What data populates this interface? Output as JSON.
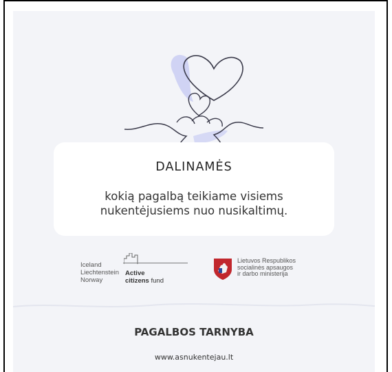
{
  "headline": "DALINAMĖS",
  "subline_1": "kokią pagalbą teikiame visiems",
  "subline_2": "nukentėjusiems nuo nusikaltimų.",
  "eea_grants": {
    "countries": [
      "Iceland",
      "Liechtenstein",
      "Norway"
    ],
    "fund_word_1": "Active",
    "fund_word_2": "citizens",
    "fund_word_3": "fund"
  },
  "ministry": {
    "line_1": "Lietuvos Respublikos",
    "line_2": "socialinės apsaugos",
    "line_3": "ir darbo ministerija"
  },
  "organization": "PAGALBOS TARNYBA",
  "website": "www.asnukentejau.lt",
  "colors": {
    "background": "#f3f4f8",
    "card": "#ffffff",
    "accent_lavender": "#c9cdf3",
    "line_art": "#3a3a4a"
  }
}
